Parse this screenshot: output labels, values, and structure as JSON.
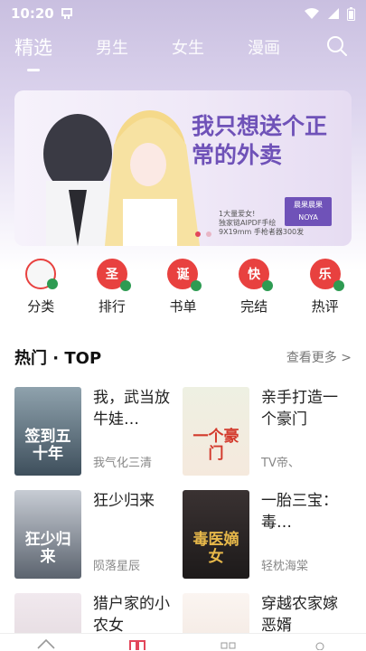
{
  "status": {
    "time": "10:20"
  },
  "tabs": [
    {
      "label": "精选",
      "active": true
    },
    {
      "label": "男生"
    },
    {
      "label": "女生"
    },
    {
      "label": "漫画"
    }
  ],
  "banner": {
    "headline": "我只想送个正常的外卖",
    "credit_lines": [
      "1大量爱女!",
      "独家链AIPDF手绘",
      "9X19mm 手枪者器300发"
    ],
    "logo": "晨果晨果\nNOYA",
    "slides": 2,
    "active_slide": 0
  },
  "quick_links": [
    {
      "label": "分类",
      "badge": ""
    },
    {
      "label": "排行",
      "badge": "圣"
    },
    {
      "label": "书单",
      "badge": "诞"
    },
    {
      "label": "完结",
      "badge": "快"
    },
    {
      "label": "热评",
      "badge": "乐"
    }
  ],
  "section": {
    "title": "热门 · TOP",
    "more": "查看更多 >"
  },
  "books": [
    {
      "title": "我，武当放牛娃…",
      "author": "我气化三清",
      "cover_text": "签到五十年",
      "cover_bg": "#5b7080",
      "cover_fg": "#ffffff"
    },
    {
      "title": "亲手打造一个豪门",
      "author": "TV帝、",
      "cover_text": "一个豪门",
      "cover_bg": "#f2f0e6",
      "cover_fg": "#d33a2c"
    },
    {
      "title": "狂少归来",
      "author": "陨落星辰",
      "cover_text": "狂少归来",
      "cover_bg": "#9aa4b0",
      "cover_fg": "#ffffff"
    },
    {
      "title": "一胎三宝：毒…",
      "author": "轻枕海棠",
      "cover_text": "毒医嫡女",
      "cover_bg": "#2f2a2a",
      "cover_fg": "#e7b84a"
    },
    {
      "title": "猎户家的小农女",
      "author": "",
      "cover_text": "",
      "cover_bg": "#f3eef0",
      "cover_fg": "#333333"
    },
    {
      "title": "穿越农家嫁恶婿",
      "author": "",
      "cover_text": "",
      "cover_bg": "#f7f2ee",
      "cover_fg": "#b3343a"
    }
  ],
  "colors": {
    "accent": "#e2465a",
    "banner_text": "#6f52b8"
  }
}
